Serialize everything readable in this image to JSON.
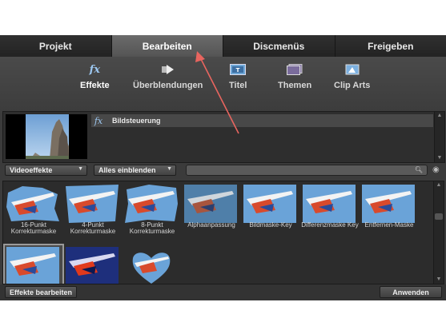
{
  "tabs": [
    "Projekt",
    "Bearbeiten",
    "Discmenüs",
    "Freigeben"
  ],
  "toolbar": {
    "items": [
      "Effekte",
      "Überblendungen",
      "Titel",
      "Themen",
      "Clip Arts"
    ],
    "icons": [
      "fx-icon",
      "transition-arrow-icon",
      "title-film-icon",
      "themes-icon",
      "clipart-icon"
    ]
  },
  "properties": {
    "effect_label": "Bildsteuerung",
    "fx_glyph": "fx"
  },
  "filters": {
    "category": "Videoeffekte",
    "view": "Alles einblenden",
    "search_placeholder": ""
  },
  "effects": [
    "16-Punkt Korrekturmaske",
    "4-Punkt Korrekturmaske",
    "8-Punkt Korrekturmaske",
    "Alphaanpassung",
    "Bildmaske-Key",
    "Differenzmaske Key",
    "Entfernen-Maske",
    "",
    "",
    ""
  ],
  "buttons": {
    "edit_effects": "Effekte bearbeiten",
    "apply": "Anwenden"
  },
  "colors": {
    "annotation_arrow": "#e8655f",
    "active_tab": "#5e5e5e",
    "background": "#3b3b3b"
  }
}
